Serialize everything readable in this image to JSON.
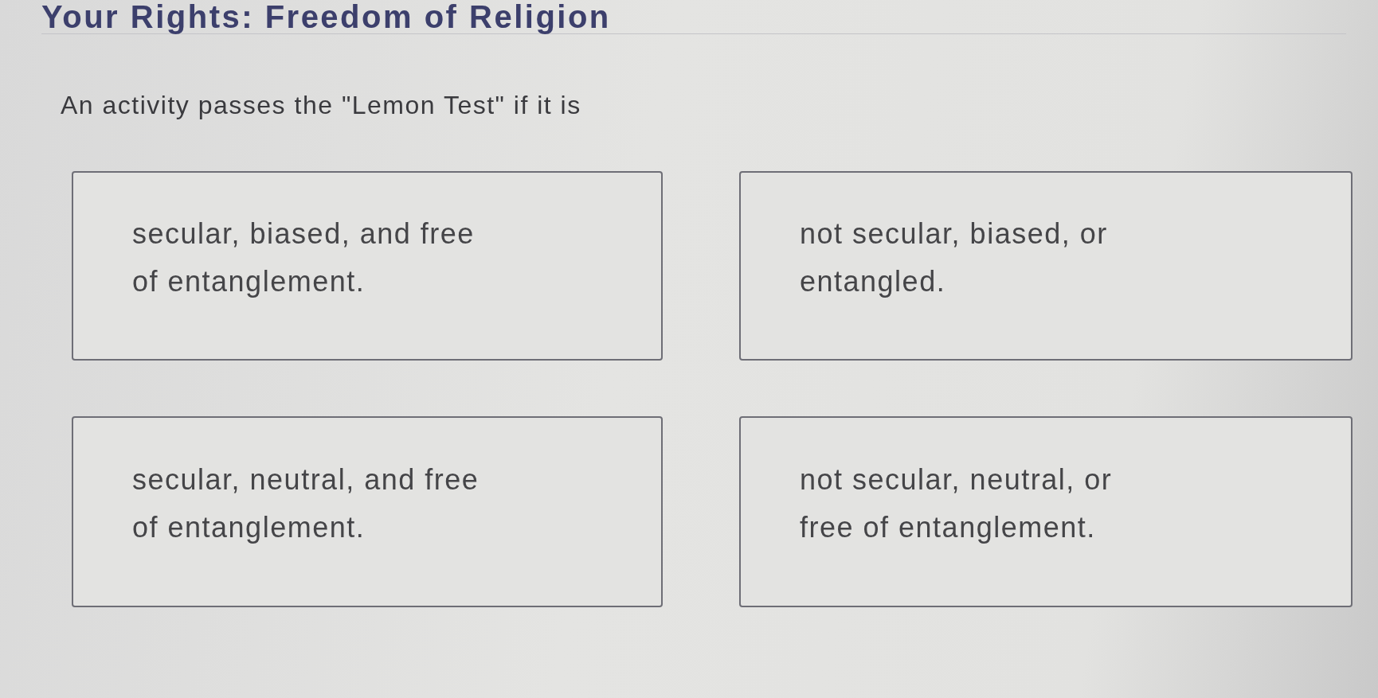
{
  "header": {
    "title": "Your Rights: Freedom of Religion"
  },
  "question": {
    "prompt": "An activity passes the \"Lemon Test\" if it is"
  },
  "options": [
    {
      "lines": [
        "secular, biased, and free",
        "of entanglement."
      ],
      "selected": false
    },
    {
      "lines": [
        "not secular, biased, or",
        "entangled."
      ],
      "selected": false
    },
    {
      "lines": [
        "secular, neutral, and free",
        "of entanglement."
      ],
      "selected": false
    },
    {
      "lines": [
        "not secular, neutral, or",
        "free of entanglement."
      ],
      "selected": false
    }
  ]
}
